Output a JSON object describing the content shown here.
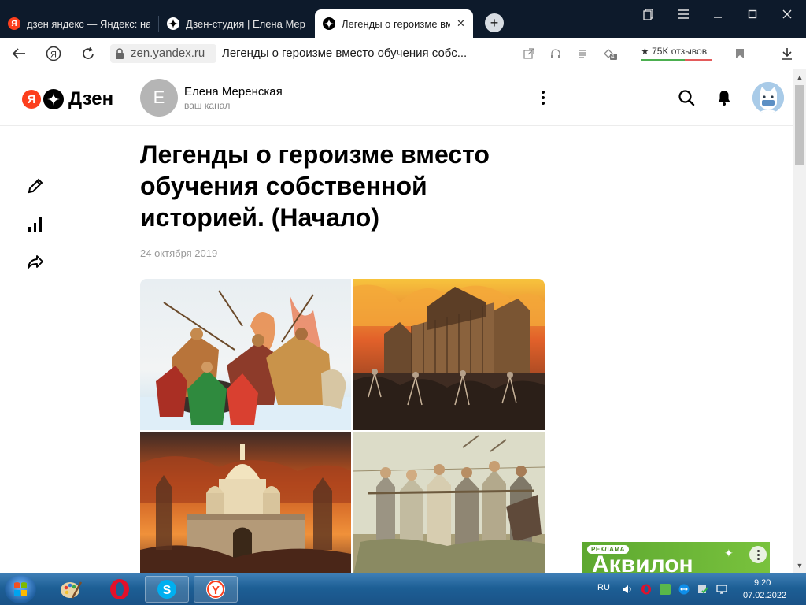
{
  "browser": {
    "tabs": [
      {
        "label": "дзен яндекс — Яндекс: на",
        "icon": "yandex-icon",
        "active": false
      },
      {
        "label": "Дзен-студия | Елена Мере",
        "icon": "dzen-icon",
        "active": false
      },
      {
        "label": "Легенды о героизме вм",
        "icon": "dzen-icon",
        "active": true
      }
    ],
    "new_tab_label": "+",
    "address": {
      "host": "zen.yandex.ru",
      "page_title": "Легенды о героизме вместо обучения собс..."
    },
    "reviews_label": "★ 75K отзывов",
    "extension_badge": "4",
    "colors": {
      "tabstrip": "#0d1a2b",
      "reviews_good": "#4caf50",
      "reviews_bad": "#e35b5b"
    }
  },
  "header": {
    "logo_ya": "Я",
    "logo_text": "Дзен",
    "channel_initial": "Е",
    "channel_name": "Елена Меренская",
    "channel_subtitle": "ваш канал"
  },
  "article": {
    "title": "Легенды о героизме вместо обучения собственной историей. (Начало)",
    "date": "24 октября 2019"
  },
  "ad": {
    "tag": "РЕКЛАМА",
    "text": "Аквилон",
    "color": "#6ab535"
  },
  "taskbar": {
    "lang": "RU",
    "time": "9:20",
    "date": "07.02.2022"
  }
}
